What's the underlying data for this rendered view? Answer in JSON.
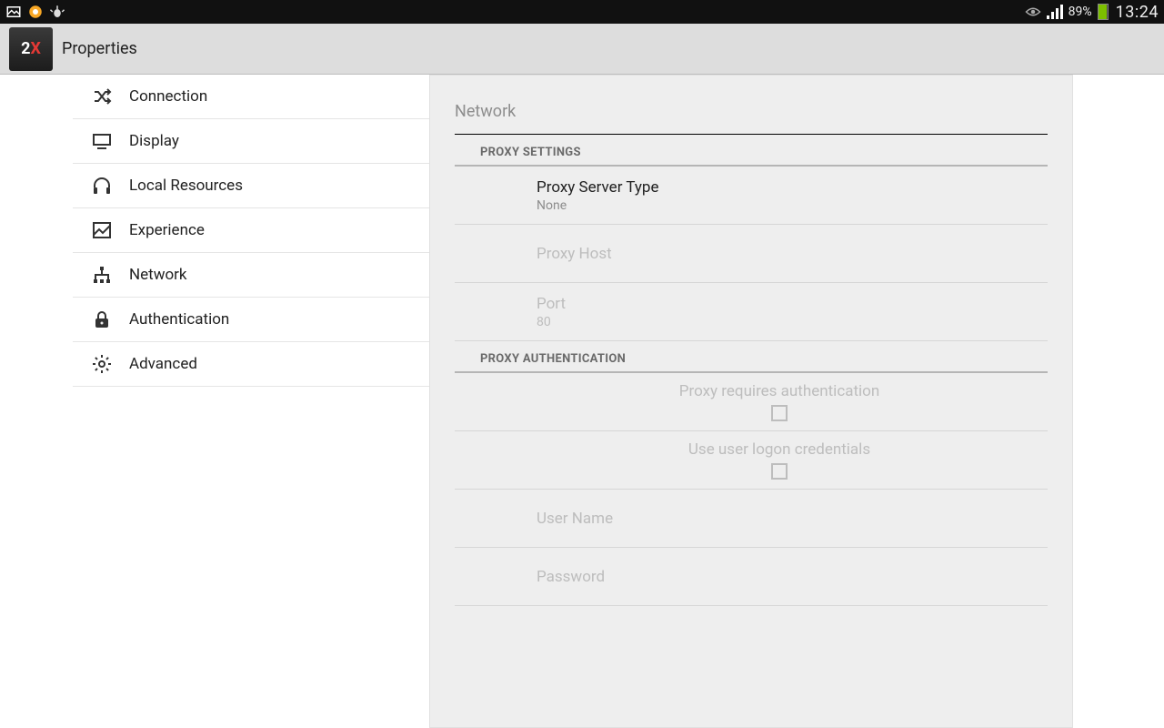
{
  "status": {
    "battery": "89%",
    "time": "13:24"
  },
  "actionbar": {
    "title": "Properties"
  },
  "sidebar": {
    "items": [
      {
        "label": "Connection"
      },
      {
        "label": "Display"
      },
      {
        "label": "Local Resources"
      },
      {
        "label": "Experience"
      },
      {
        "label": "Network"
      },
      {
        "label": "Authentication"
      },
      {
        "label": "Advanced"
      }
    ],
    "selected_index": 4
  },
  "panel": {
    "title": "Network",
    "sections": [
      {
        "header": "PROXY SETTINGS",
        "prefs": [
          {
            "title": "Proxy Server Type",
            "sub": "None",
            "enabled": true
          },
          {
            "title": "Proxy Host",
            "sub": "",
            "enabled": false
          },
          {
            "title": "Port",
            "sub": "80",
            "enabled": false
          }
        ]
      },
      {
        "header": "PROXY AUTHENTICATION",
        "prefs": [
          {
            "title": "Proxy requires authentication",
            "checkbox": true,
            "checked": false,
            "enabled": false
          },
          {
            "title": "Use user logon credentials",
            "checkbox": true,
            "checked": false,
            "enabled": false
          },
          {
            "title": "User Name",
            "enabled": false
          },
          {
            "title": "Password",
            "enabled": false
          }
        ]
      }
    ]
  }
}
